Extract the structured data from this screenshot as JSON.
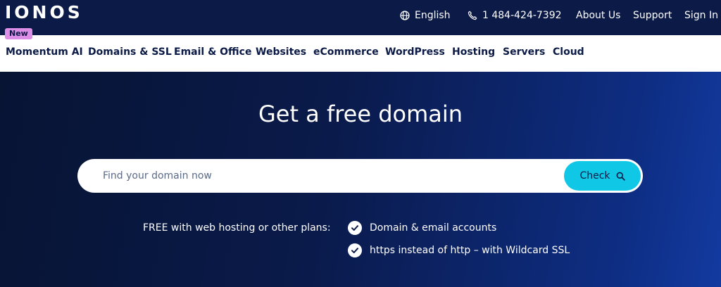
{
  "header": {
    "logo": "IONOS",
    "badge": "New",
    "language": "English",
    "phone": "1 484-424-7392",
    "about": "About Us",
    "support": "Support",
    "signin": "Sign In"
  },
  "nav": {
    "items": [
      "Momentum AI",
      "Domains & SSL",
      "Email & Office",
      "Websites",
      "eCommerce",
      "WordPress",
      "Hosting",
      "Servers",
      "Cloud"
    ]
  },
  "hero": {
    "title": "Get a free domain",
    "search_placeholder": "Find your domain now",
    "check_label": "Check",
    "free_label": "FREE with web hosting or other plans:",
    "features": [
      "Domain & email accounts",
      "https instead of http – with Wildcard SSL"
    ]
  },
  "colors": {
    "brand_dark": "#0b1a46",
    "accent_cyan": "#11c7e6",
    "badge_pink": "#dd8fe8"
  }
}
